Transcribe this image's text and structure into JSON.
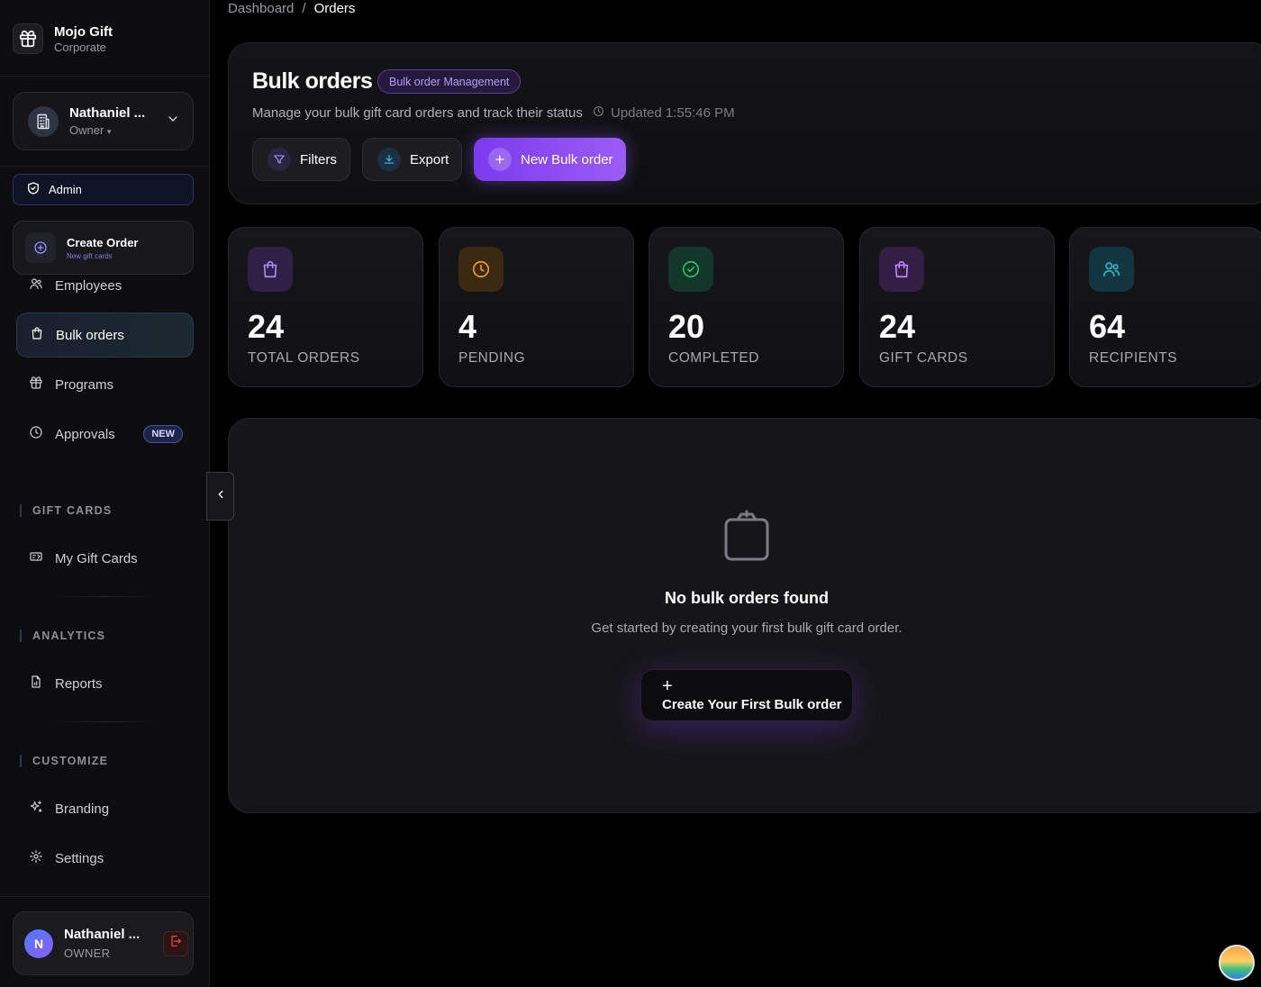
{
  "brand": {
    "title": "Mojo Gift",
    "subtitle": "Corporate"
  },
  "account": {
    "name": "Nathaniel ...",
    "role": "Owner",
    "role_suffix": "▾"
  },
  "admin_label": "Admin",
  "create_order": {
    "title": "Create Order",
    "subtitle": "New gift cards"
  },
  "nav": {
    "employees": "Employees",
    "bulk_orders": "Bulk orders",
    "programs": "Programs",
    "approvals": "Approvals",
    "approvals_badge": "NEW"
  },
  "sections": {
    "gift_cards": {
      "title": "GIFT CARDS",
      "items": [
        "My Gift Cards"
      ]
    },
    "analytics": {
      "title": "ANALYTICS",
      "items": [
        "Reports"
      ]
    },
    "customize": {
      "title": "CUSTOMIZE",
      "items": [
        "Branding",
        "Settings"
      ]
    }
  },
  "user": {
    "initial": "N",
    "name": "Nathaniel ...",
    "role": "OWNER"
  },
  "breadcrumb": {
    "root": "Dashboard",
    "separator": "/",
    "current": "Orders"
  },
  "header": {
    "title": "Bulk orders",
    "badge": "Bulk order Management",
    "description": "Manage your bulk gift card orders and track their status",
    "updated": "Updated 1:55:46 PM",
    "buttons": {
      "filters": "Filters",
      "export": "Export",
      "new": "New Bulk order"
    }
  },
  "stats": [
    {
      "value": "24",
      "label": "TOTAL ORDERS",
      "icon": "shopping-bag-icon",
      "color": "#8b5cf6"
    },
    {
      "value": "4",
      "label": "PENDING",
      "icon": "clock-icon",
      "color": "#f59e0b"
    },
    {
      "value": "20",
      "label": "COMPLETED",
      "icon": "check-circle-icon",
      "color": "#22c55e"
    },
    {
      "value": "24",
      "label": "GIFT CARDS",
      "icon": "shopping-bag-icon",
      "color": "#a855f7"
    },
    {
      "value": "64",
      "label": "RECIPIENTS",
      "icon": "users-icon",
      "color": "#22b8cf"
    }
  ],
  "empty_state": {
    "title": "No bulk orders found",
    "description": "Get started by creating your first bulk gift card order.",
    "button_icon": "+",
    "button": "Create Your First Bulk order"
  },
  "colors": {
    "accent": "#8b5cf6",
    "background": "#000000",
    "card": "#161619"
  }
}
